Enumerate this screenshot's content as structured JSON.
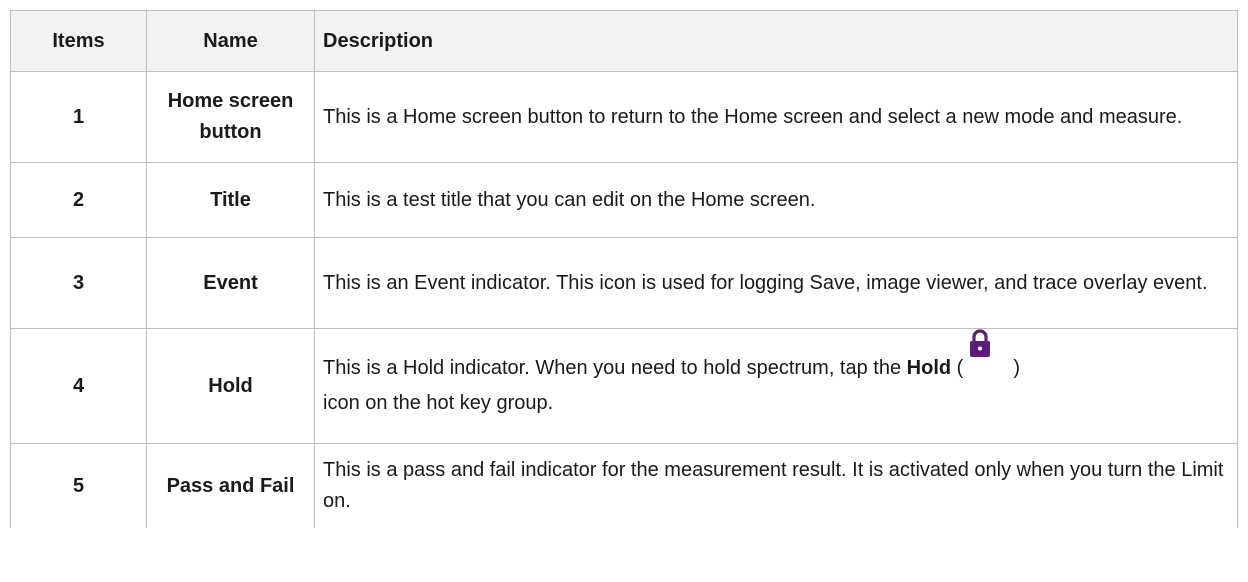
{
  "header": {
    "items": "Items",
    "name": "Name",
    "description": "Description"
  },
  "rows": [
    {
      "item": "1",
      "name": "Home screen button",
      "description": "This is a Home screen button to return to the Home screen and select a new mode and measure."
    },
    {
      "item": "2",
      "name": "Title",
      "description": "This is a test title that you can edit on the Home screen."
    },
    {
      "item": "3",
      "name": "Event",
      "description": "This is an Event indicator. This icon is used for logging Save, image viewer, and trace overlay event."
    },
    {
      "item": "4",
      "name": "Hold",
      "description_pre": "This is a Hold indicator. When you need to hold spectrum, tap the ",
      "description_bold": "Hold",
      "description_open": " (",
      "description_close": ")",
      "description_post": "icon on the hot key group.",
      "icon": "lock-icon"
    },
    {
      "item": "5",
      "name": "Pass and Fail",
      "description": "This is a pass and fail indicator for the measurement result. It is activated only when you turn the Limit on."
    }
  ],
  "colors": {
    "header_bg": "#f2f2f2",
    "border": "#bfbfbf",
    "lock_icon": "#5b1f7a"
  }
}
